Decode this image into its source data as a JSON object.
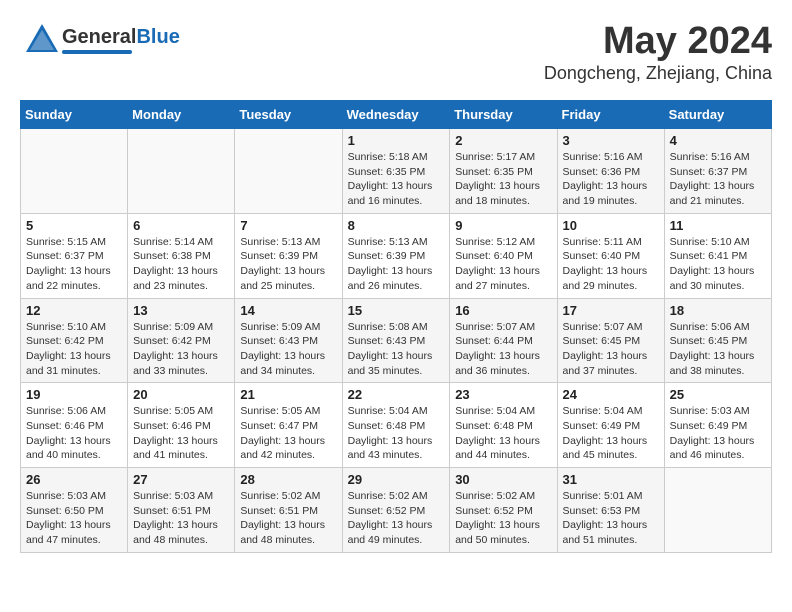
{
  "header": {
    "logo_text_general": "General",
    "logo_text_blue": "Blue",
    "main_title": "May 2024",
    "subtitle": "Dongcheng, Zhejiang, China"
  },
  "days_of_week": [
    "Sunday",
    "Monday",
    "Tuesday",
    "Wednesday",
    "Thursday",
    "Friday",
    "Saturday"
  ],
  "weeks": [
    [
      {
        "day": "",
        "info": ""
      },
      {
        "day": "",
        "info": ""
      },
      {
        "day": "",
        "info": ""
      },
      {
        "day": "1",
        "info": "Sunrise: 5:18 AM\nSunset: 6:35 PM\nDaylight: 13 hours\nand 16 minutes."
      },
      {
        "day": "2",
        "info": "Sunrise: 5:17 AM\nSunset: 6:35 PM\nDaylight: 13 hours\nand 18 minutes."
      },
      {
        "day": "3",
        "info": "Sunrise: 5:16 AM\nSunset: 6:36 PM\nDaylight: 13 hours\nand 19 minutes."
      },
      {
        "day": "4",
        "info": "Sunrise: 5:16 AM\nSunset: 6:37 PM\nDaylight: 13 hours\nand 21 minutes."
      }
    ],
    [
      {
        "day": "5",
        "info": "Sunrise: 5:15 AM\nSunset: 6:37 PM\nDaylight: 13 hours\nand 22 minutes."
      },
      {
        "day": "6",
        "info": "Sunrise: 5:14 AM\nSunset: 6:38 PM\nDaylight: 13 hours\nand 23 minutes."
      },
      {
        "day": "7",
        "info": "Sunrise: 5:13 AM\nSunset: 6:39 PM\nDaylight: 13 hours\nand 25 minutes."
      },
      {
        "day": "8",
        "info": "Sunrise: 5:13 AM\nSunset: 6:39 PM\nDaylight: 13 hours\nand 26 minutes."
      },
      {
        "day": "9",
        "info": "Sunrise: 5:12 AM\nSunset: 6:40 PM\nDaylight: 13 hours\nand 27 minutes."
      },
      {
        "day": "10",
        "info": "Sunrise: 5:11 AM\nSunset: 6:40 PM\nDaylight: 13 hours\nand 29 minutes."
      },
      {
        "day": "11",
        "info": "Sunrise: 5:10 AM\nSunset: 6:41 PM\nDaylight: 13 hours\nand 30 minutes."
      }
    ],
    [
      {
        "day": "12",
        "info": "Sunrise: 5:10 AM\nSunset: 6:42 PM\nDaylight: 13 hours\nand 31 minutes."
      },
      {
        "day": "13",
        "info": "Sunrise: 5:09 AM\nSunset: 6:42 PM\nDaylight: 13 hours\nand 33 minutes."
      },
      {
        "day": "14",
        "info": "Sunrise: 5:09 AM\nSunset: 6:43 PM\nDaylight: 13 hours\nand 34 minutes."
      },
      {
        "day": "15",
        "info": "Sunrise: 5:08 AM\nSunset: 6:43 PM\nDaylight: 13 hours\nand 35 minutes."
      },
      {
        "day": "16",
        "info": "Sunrise: 5:07 AM\nSunset: 6:44 PM\nDaylight: 13 hours\nand 36 minutes."
      },
      {
        "day": "17",
        "info": "Sunrise: 5:07 AM\nSunset: 6:45 PM\nDaylight: 13 hours\nand 37 minutes."
      },
      {
        "day": "18",
        "info": "Sunrise: 5:06 AM\nSunset: 6:45 PM\nDaylight: 13 hours\nand 38 minutes."
      }
    ],
    [
      {
        "day": "19",
        "info": "Sunrise: 5:06 AM\nSunset: 6:46 PM\nDaylight: 13 hours\nand 40 minutes."
      },
      {
        "day": "20",
        "info": "Sunrise: 5:05 AM\nSunset: 6:46 PM\nDaylight: 13 hours\nand 41 minutes."
      },
      {
        "day": "21",
        "info": "Sunrise: 5:05 AM\nSunset: 6:47 PM\nDaylight: 13 hours\nand 42 minutes."
      },
      {
        "day": "22",
        "info": "Sunrise: 5:04 AM\nSunset: 6:48 PM\nDaylight: 13 hours\nand 43 minutes."
      },
      {
        "day": "23",
        "info": "Sunrise: 5:04 AM\nSunset: 6:48 PM\nDaylight: 13 hours\nand 44 minutes."
      },
      {
        "day": "24",
        "info": "Sunrise: 5:04 AM\nSunset: 6:49 PM\nDaylight: 13 hours\nand 45 minutes."
      },
      {
        "day": "25",
        "info": "Sunrise: 5:03 AM\nSunset: 6:49 PM\nDaylight: 13 hours\nand 46 minutes."
      }
    ],
    [
      {
        "day": "26",
        "info": "Sunrise: 5:03 AM\nSunset: 6:50 PM\nDaylight: 13 hours\nand 47 minutes."
      },
      {
        "day": "27",
        "info": "Sunrise: 5:03 AM\nSunset: 6:51 PM\nDaylight: 13 hours\nand 48 minutes."
      },
      {
        "day": "28",
        "info": "Sunrise: 5:02 AM\nSunset: 6:51 PM\nDaylight: 13 hours\nand 48 minutes."
      },
      {
        "day": "29",
        "info": "Sunrise: 5:02 AM\nSunset: 6:52 PM\nDaylight: 13 hours\nand 49 minutes."
      },
      {
        "day": "30",
        "info": "Sunrise: 5:02 AM\nSunset: 6:52 PM\nDaylight: 13 hours\nand 50 minutes."
      },
      {
        "day": "31",
        "info": "Sunrise: 5:01 AM\nSunset: 6:53 PM\nDaylight: 13 hours\nand 51 minutes."
      },
      {
        "day": "",
        "info": ""
      }
    ]
  ]
}
